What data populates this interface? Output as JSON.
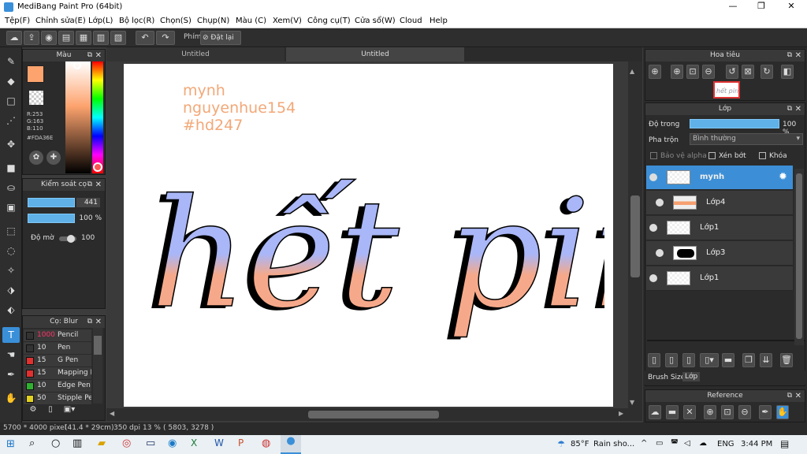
{
  "app": {
    "title": "MediBang Paint Pro (64bit)"
  },
  "menu": [
    "Tệp(F)",
    "Chỉnh sửa(E)",
    "Lớp(L)",
    "Bộ lọc(R)",
    "Chọn(S)",
    "Chụp(N)",
    "Màu (C)",
    "Xem(V)",
    "Công cụ(T)",
    "Cửa sổ(W)",
    "Cloud",
    "Help"
  ],
  "toolbar": {
    "shortcut_label": "Phím",
    "reset_label": "Đặt lại"
  },
  "tabs": [
    "Untitled",
    "Untitled"
  ],
  "color_panel": {
    "title": "Màu",
    "r": "R:253",
    "g": "G:163",
    "b": "B:110",
    "hex": "#FDA36E",
    "fg_color": "#FDA36E"
  },
  "brush_control": {
    "title": "Kiểm soát cọ",
    "size_value": "441",
    "opacity_value": "100 %",
    "blur_label": "Độ mờ",
    "blur_value": "100"
  },
  "brush_panel": {
    "title": "Cọ: Blur",
    "brushes": [
      {
        "size": "1000",
        "name": "Pencil",
        "color": "#333333"
      },
      {
        "size": "10",
        "name": "Pen",
        "color": "#333333"
      },
      {
        "size": "15",
        "name": "G Pen",
        "color": "#e03030"
      },
      {
        "size": "15",
        "name": "Mapping P",
        "color": "#e03030"
      },
      {
        "size": "10",
        "name": "Edge Pen",
        "color": "#30b030"
      },
      {
        "size": "50",
        "name": "Stipple Pe",
        "color": "#e0d020"
      }
    ]
  },
  "canvas": {
    "text_lines": [
      "mynh",
      "nguyenhue154",
      "#hd247"
    ],
    "lettering": "hết pin",
    "text_color": "#F2A878"
  },
  "navigator": {
    "title": "Hoa tiêu"
  },
  "layers_panel": {
    "title": "Lớp",
    "opacity_label": "Độ trong",
    "opacity_value": "100 %",
    "blend_label": "Pha trộn",
    "blend_value": "Bình thường",
    "protect_alpha": "Bảo vệ alpha",
    "clipping": "Xén bớt",
    "lock": "Khóa",
    "layers": [
      {
        "name": "mynh",
        "selected": true
      },
      {
        "name": "Lớp4",
        "selected": false
      },
      {
        "name": "Lớp1",
        "selected": false
      },
      {
        "name": "Lớp3",
        "selected": false
      },
      {
        "name": "Lớp1",
        "selected": false
      }
    ],
    "bottom_tabs": [
      "Brush Size",
      "Lớp"
    ]
  },
  "reference": {
    "title": "Reference"
  },
  "status": {
    "dimensions": "5700 * 4000 pixel",
    "size_cm": "(41.4 * 29cm)",
    "dpi": "350 dpi",
    "zoom": "13 %",
    "coords": "( 5803, 3278 )"
  },
  "taskbar": {
    "weather_temp": "85°F",
    "weather_desc": "Rain sho...",
    "lang": "ENG",
    "time": "3:44 PM"
  }
}
